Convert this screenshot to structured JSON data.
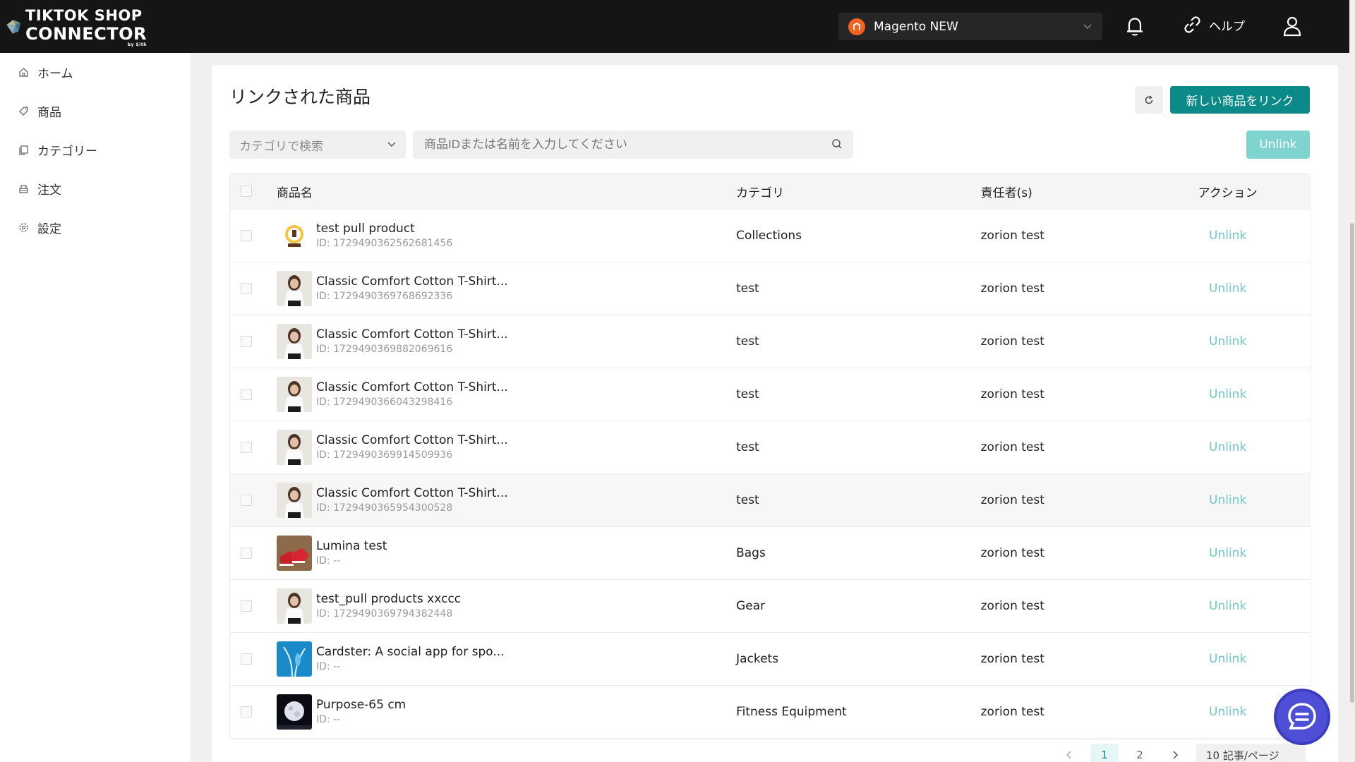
{
  "app": {
    "logo_line1": "TIKTOK SHOP",
    "logo_line2": "CONNECTOR",
    "logo_line3": "by Sith"
  },
  "header": {
    "store_name": "Magento NEW",
    "help_label": "ヘルプ"
  },
  "sidebar": {
    "items": [
      {
        "label": "ホーム",
        "icon": "home-icon"
      },
      {
        "label": "商品",
        "icon": "tag-icon"
      },
      {
        "label": "カテゴリー",
        "icon": "copy-icon"
      },
      {
        "label": "注文",
        "icon": "order-icon"
      },
      {
        "label": "設定",
        "icon": "gear-icon"
      }
    ]
  },
  "main": {
    "title": "リンクされた商品",
    "link_new_label": "新しい商品をリンク",
    "category_filter_placeholder": "カテゴリで検索",
    "search_placeholder": "商品IDまたは名前を入力してください",
    "unlink_label": "Unlink"
  },
  "table": {
    "headers": {
      "name": "商品名",
      "category": "カテゴリ",
      "owner": "責任者(s)",
      "action": "アクション"
    },
    "rows": [
      {
        "name": "test pull product",
        "id": "ID: 1729490362562681456",
        "category": "Collections",
        "owner": "zorion test",
        "action": "Unlink",
        "thumb": "trophy"
      },
      {
        "name": "Classic Comfort Cotton T-Shirt...",
        "id": "ID: 1729490369768692336",
        "category": "test",
        "owner": "zorion test",
        "action": "Unlink",
        "thumb": "woman"
      },
      {
        "name": "Classic Comfort Cotton T-Shirt...",
        "id": "ID: 1729490369882069616",
        "category": "test",
        "owner": "zorion test",
        "action": "Unlink",
        "thumb": "woman"
      },
      {
        "name": "Classic Comfort Cotton T-Shirt...",
        "id": "ID: 1729490366043298416",
        "category": "test",
        "owner": "zorion test",
        "action": "Unlink",
        "thumb": "woman"
      },
      {
        "name": "Classic Comfort Cotton T-Shirt...",
        "id": "ID: 1729490369914509936",
        "category": "test",
        "owner": "zorion test",
        "action": "Unlink",
        "thumb": "woman"
      },
      {
        "name": "Classic Comfort Cotton T-Shirt...",
        "id": "ID: 1729490365954300528",
        "category": "test",
        "owner": "zorion test",
        "action": "Unlink",
        "thumb": "woman"
      },
      {
        "name": "Lumina test",
        "id": "ID: --",
        "category": "Bags",
        "owner": "zorion test",
        "action": "Unlink",
        "thumb": "shoes"
      },
      {
        "name": "test_pull products xxccc",
        "id": "ID: 1729490369794382448",
        "category": "Gear",
        "owner": "zorion test",
        "action": "Unlink",
        "thumb": "woman"
      },
      {
        "name": "Cardster: A social app for spo...",
        "id": "ID: --",
        "category": "Jackets",
        "owner": "zorion test",
        "action": "Unlink",
        "thumb": "plant"
      },
      {
        "name": "Purpose-65 cm",
        "id": "ID: --",
        "category": "Fitness Equipment",
        "owner": "zorion test",
        "action": "Unlink",
        "thumb": "moon"
      }
    ]
  },
  "pagination": {
    "pages": [
      "1",
      "2"
    ],
    "current": "1",
    "per_page": "10 記事/ページ"
  },
  "colors": {
    "primary": "#0c8a8a",
    "link": "#6fc8c4",
    "header_bg": "#151515"
  }
}
